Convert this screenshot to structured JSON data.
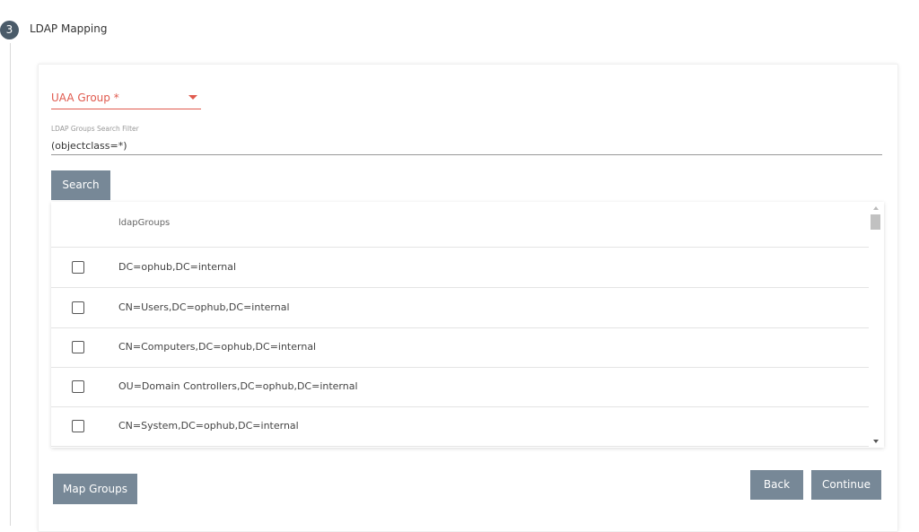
{
  "step": {
    "number": "3",
    "title": "LDAP Mapping"
  },
  "uaa_group": {
    "label": "UAA Group *"
  },
  "filter": {
    "caption": "LDAP Groups Search Filter",
    "value": "(objectclass=*)"
  },
  "buttons": {
    "search": "Search",
    "map_groups": "Map Groups",
    "back": "Back",
    "continue": "Continue"
  },
  "table": {
    "header": "ldapGroups",
    "rows": [
      {
        "label": "DC=ophub,DC=internal",
        "checked": false
      },
      {
        "label": "CN=Users,DC=ophub,DC=internal",
        "checked": false
      },
      {
        "label": "CN=Computers,DC=ophub,DC=internal",
        "checked": false
      },
      {
        "label": "OU=Domain Controllers,DC=ophub,DC=internal",
        "checked": false
      },
      {
        "label": "CN=System,DC=ophub,DC=internal",
        "checked": false
      }
    ]
  },
  "colors": {
    "accent_red": "#e05a4e",
    "button_gray": "#778897",
    "step_circle": "#4a5b69"
  },
  "icons": {
    "dropdown": "caret-down-icon",
    "scroll_up": "scroll-up-arrow-icon",
    "scroll_down": "scroll-down-arrow-icon"
  }
}
